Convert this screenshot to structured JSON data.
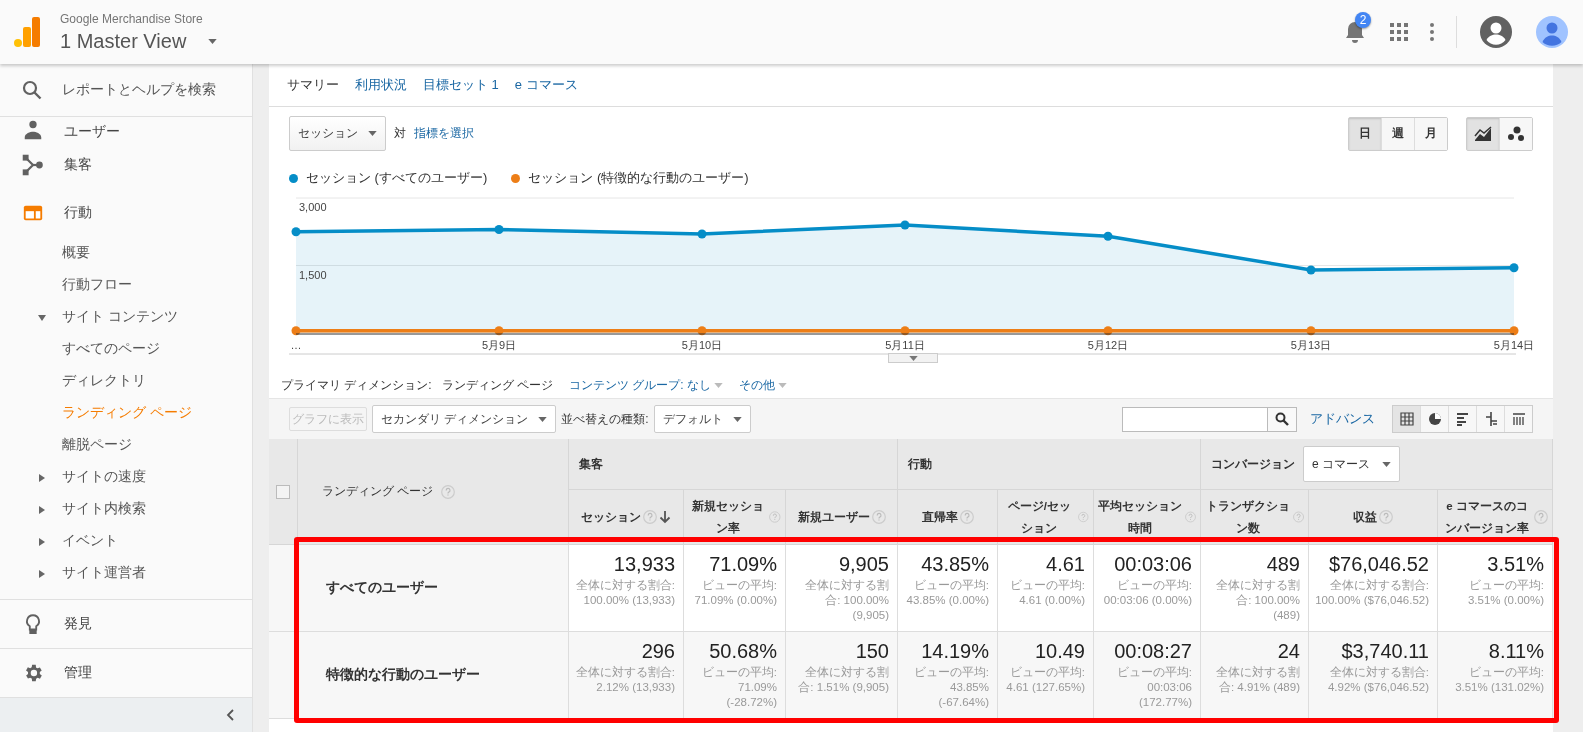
{
  "header": {
    "account": "Google Merchandise Store",
    "view": "1 Master View",
    "notification_count": "2"
  },
  "sidebar": {
    "search": "レポートとヘルプを検索",
    "sections": [
      [
        {
          "label": "ユーザー",
          "kind": "person",
          "selected": false
        },
        {
          "label": "集客",
          "kind": "branch",
          "selected": false
        },
        {
          "label": "行動",
          "kind": "layout",
          "selected": true,
          "children": [
            {
              "label": "概要",
              "selected": false
            },
            {
              "label": "行動フロー",
              "selected": false
            },
            {
              "label": "サイト コンテンツ",
              "selected": false,
              "expanded": true,
              "children": [
                {
                  "label": "すべてのページ",
                  "selected": false
                },
                {
                  "label": "ディレクトリ",
                  "selected": false
                },
                {
                  "label": "ランディング ページ",
                  "selected": true
                },
                {
                  "label": "離脱ページ",
                  "selected": false
                }
              ]
            },
            {
              "label": "サイトの速度",
              "selected": false,
              "expanded": false
            },
            {
              "label": "サイト内検索",
              "selected": false,
              "expanded": false
            },
            {
              "label": "イベント",
              "selected": false,
              "expanded": false
            },
            {
              "label": "サイト運営者",
              "selected": false,
              "expanded": false
            }
          ]
        }
      ],
      [
        {
          "label": "発見",
          "kind": "bulb",
          "selected": false
        }
      ],
      [
        {
          "label": "管理",
          "kind": "gear",
          "selected": false
        }
      ]
    ]
  },
  "tabs": [
    {
      "label": "サマリー",
      "selected": true
    },
    {
      "label": "利用状況",
      "selected": false
    },
    {
      "label": "目標セット 1",
      "selected": false
    },
    {
      "label": "e コマース",
      "selected": false
    }
  ],
  "metric_select": {
    "value": "セッション",
    "versus": "対",
    "link": "指標を選択"
  },
  "granularity": [
    {
      "label": "日",
      "selected": true
    },
    {
      "label": "週",
      "selected": false
    },
    {
      "label": "月",
      "selected": false
    }
  ],
  "chart_types": [
    {
      "kind": "line",
      "selected": true
    },
    {
      "kind": "bubble",
      "selected": false
    }
  ],
  "chart_data": {
    "type": "area",
    "categories": [
      "…",
      "5月9日",
      "5月10日",
      "5月11日",
      "5月12日",
      "5月13日",
      "5月14日"
    ],
    "series": [
      {
        "name": "セッション (すべてのユーザー)",
        "color": "#058dc7",
        "marker": "circle",
        "values": [
          2250,
          2300,
          2200,
          2400,
          2150,
          1400,
          1450
        ]
      },
      {
        "name": "セッション (特徴的な行動のユーザー)",
        "color": "#ed7e17",
        "marker": "circle",
        "values": [
          50,
          50,
          50,
          50,
          50,
          50,
          50
        ]
      }
    ],
    "ylim": [
      0,
      3000
    ],
    "yticks": [
      {
        "value": 1500,
        "label": "1,500"
      },
      {
        "value": 3000,
        "label": "3,000"
      }
    ]
  },
  "dimension_bar": {
    "label": "プライマリ ディメンション:",
    "items": [
      {
        "label": "ランディング ページ",
        "kind": "current"
      },
      {
        "label": "コンテンツ グループ: なし",
        "kind": "menu"
      },
      {
        "label": "その他",
        "kind": "menu"
      }
    ]
  },
  "toolbar": {
    "plot_button": {
      "label": "グラフに表示",
      "disabled": true
    },
    "secondary": "セカンダリ ディメンション",
    "sort_label": "並べ替えの種類:",
    "sort": "デフォルト",
    "advanced": "アドバンス",
    "views": [
      {
        "kind": "table",
        "selected": true
      },
      {
        "kind": "pie",
        "selected": false
      },
      {
        "kind": "bars",
        "selected": false
      },
      {
        "kind": "compare",
        "selected": false
      },
      {
        "kind": "pivot",
        "selected": false
      }
    ]
  },
  "table": {
    "dimension_header": "ランディング ページ",
    "select_all_checked": false,
    "highlight_frame": true,
    "groups": [
      {
        "label": "集客",
        "columns": [
          {
            "label": "セッション",
            "sorted": true
          },
          {
            "label": "新規セッション率",
            "sorted": false
          },
          {
            "label": "新規ユーザー",
            "sorted": false
          }
        ]
      },
      {
        "label": "行動",
        "columns": [
          {
            "label": "直帰率",
            "sorted": false
          },
          {
            "label": "ページ/セッション",
            "sorted": false
          },
          {
            "label": "平均セッション時間",
            "sorted": false
          }
        ]
      },
      {
        "label": "コンバージョン",
        "dropdown": "e コマース",
        "columns": [
          {
            "label": "トランザクション数",
            "sorted": false
          },
          {
            "label": "収益",
            "sorted": false
          },
          {
            "label": "e コマースのコンバージョン率",
            "sorted": false
          }
        ]
      }
    ],
    "rows": [
      {
        "name": "すべてのユーザー",
        "cells": [
          {
            "value": "13,933",
            "sub": "全体に対する割合: 100.00% (13,933)"
          },
          {
            "value": "71.09%",
            "sub": "ビューの平均: 71.09% (0.00%)"
          },
          {
            "value": "9,905",
            "sub": "全体に対する割合: 100.00% (9,905)"
          },
          {
            "value": "43.85%",
            "sub": "ビューの平均: 43.85% (0.00%)"
          },
          {
            "value": "4.61",
            "sub": "ビューの平均: 4.61 (0.00%)"
          },
          {
            "value": "00:03:06",
            "sub": "ビューの平均: 00:03:06 (0.00%)"
          },
          {
            "value": "489",
            "sub": "全体に対する割合: 100.00% (489)"
          },
          {
            "value": "$76,046.52",
            "sub": "全体に対する割合: 100.00% ($76,046.52)"
          },
          {
            "value": "3.51%",
            "sub": "ビューの平均: 3.51% (0.00%)"
          }
        ]
      },
      {
        "name": "特徴的な行動のユーザー",
        "cells": [
          {
            "value": "296",
            "sub": "全体に対する割合: 2.12% (13,933)"
          },
          {
            "value": "50.68%",
            "sub": "ビューの平均: 71.09% (-28.72%)"
          },
          {
            "value": "150",
            "sub": "全体に対する割合: 1.51% (9,905)"
          },
          {
            "value": "14.19%",
            "sub": "ビューの平均: 43.85% (-67.64%)"
          },
          {
            "value": "10.49",
            "sub": "ビューの平均: 4.61 (127.65%)"
          },
          {
            "value": "00:08:27",
            "sub": "ビューの平均: 00:03:06 (172.77%)"
          },
          {
            "value": "24",
            "sub": "全体に対する割合: 4.91% (489)"
          },
          {
            "value": "$3,740.11",
            "sub": "全体に対する割合: 4.92% ($76,046.52)"
          },
          {
            "value": "8.11%",
            "sub": "ビューの平均: 3.51% (131.02%)"
          }
        ]
      }
    ]
  }
}
